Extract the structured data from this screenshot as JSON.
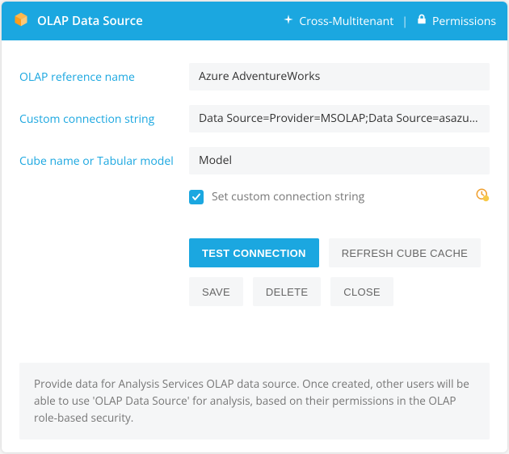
{
  "header": {
    "title": "OLAP Data Source",
    "crossMultitenant": "Cross-Multitenant",
    "permissions": "Permissions"
  },
  "form": {
    "refNameLabel": "OLAP reference name",
    "refNameValue": "Azure AdventureWorks",
    "connStrLabel": "Custom connection string",
    "connStrValue": "Data Source=Provider=MSOLAP;Data Source=asazure://west",
    "cubeLabel": "Cube name or Tabular model",
    "cubeValue": "Model",
    "checkboxLabel": "Set custom connection string"
  },
  "buttons": {
    "test": "TEST CONNECTION",
    "refresh": "REFRESH CUBE CACHE",
    "save": "SAVE",
    "delete": "DELETE",
    "close": "CLOSE"
  },
  "footer": "Provide data for Analysis Services OLAP data source. Once created, other users will be able to use 'OLAP Data Source' for analysis, based on their permissions in the OLAP role-based security."
}
